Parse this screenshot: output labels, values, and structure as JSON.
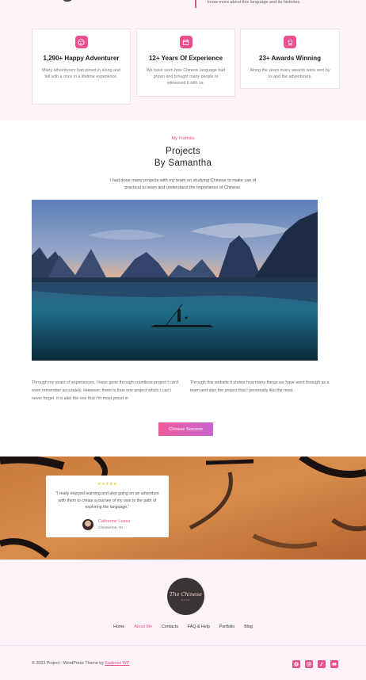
{
  "top": {
    "quote_text": "know more about this language and its histories."
  },
  "stats": [
    {
      "icon": "smile-icon",
      "title": "1,290+ Happy Adventurer",
      "desc": "Many adventurers had joined in along and fell with a once in a lifetime experience."
    },
    {
      "icon": "calendar-icon",
      "title": "12+ Years Of Experience",
      "desc": "We have seen how Chinese language had grown and brought many people to witnessed it with us."
    },
    {
      "icon": "award-icon",
      "title": "23+ Awards Winning",
      "desc": "Along the years many awards were won by us and the adventurers."
    }
  ],
  "portfolio": {
    "eyebrow": "My Portfolio",
    "title_line1": "Projects",
    "title_line2": "By Samantha",
    "subtitle": "I had done many projects with my team on studying Chinese to make use of practical to learn and understand the importance of Chinese.",
    "left_text": "Through my years of experiences, I have gone through countless project I can't even remember accurately. However, there is thus one project which I can't never forget, it is also the one that I'm most proud in",
    "right_text": "Through this website it shows how many things we have went through as a team and also the project that I personally like the most.",
    "button_label": "Chinese Success"
  },
  "testimonial": {
    "stars": "★★★★★",
    "quote": "\"I really enjoyed learning and also going on an adventure with them to create a journey of my own to the path of exploring the language.\"",
    "author_name": "Catherine Lopez",
    "author_location": "Chesterton, IN"
  },
  "footer": {
    "logo_script": "The Chinese",
    "logo_small": "PATH",
    "nav": [
      "Home",
      "About Me",
      "Contacts",
      "FAQ & Help",
      "Portfolio",
      "Blog"
    ],
    "active_nav": "About Me",
    "copyright_prefix": "© 2023 Project - WordPress Theme by",
    "copyright_link": "Kadence WP",
    "socials": [
      "facebook-icon",
      "instagram-icon",
      "tiktok-icon",
      "youtube-icon"
    ]
  },
  "colors": {
    "accent": "#ec4f8e",
    "section_bg": "#fcf4f8"
  }
}
